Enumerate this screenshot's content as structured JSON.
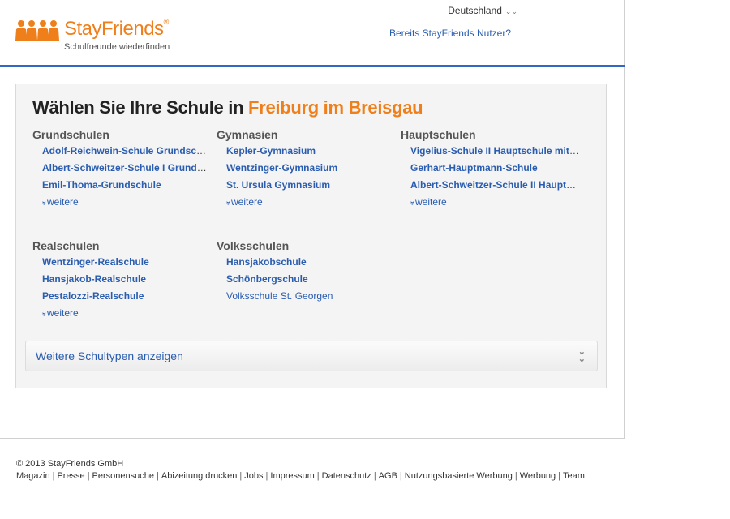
{
  "header": {
    "brand": "StayFriends",
    "brand_mark": "®",
    "tagline": "Schulfreunde wiederfinden",
    "country": "Deutschland",
    "login_link": "Bereits StayFriends Nutzer?",
    "accent_color": "#ef7f1a",
    "link_color": "#2a5db0",
    "rule_color": "#3367c7"
  },
  "main": {
    "title_prefix": "Wählen Sie Ihre Schule in",
    "city": "Freiburg im Breisgau",
    "more_label": "weitere",
    "more_icon": "double-chevron-down-icon",
    "categories": [
      {
        "name": "Grundschulen",
        "schools": [
          "Adolf-Reichwein-Schule Grundschule",
          "Albert-Schweitzer-Schule I Grundschule",
          "Emil-Thoma-Grundschule"
        ],
        "has_more": true
      },
      {
        "name": "Gymnasien",
        "schools": [
          "Kepler-Gymnasium",
          "Wentzinger-Gymnasium",
          "St. Ursula Gymnasium"
        ],
        "has_more": true
      },
      {
        "name": "Hauptschulen",
        "schools": [
          "Vigelius-Schule II Hauptschule mit Werkrealschule",
          "Gerhart-Hauptmann-Schule",
          "Albert-Schweitzer-Schule II Hauptschule"
        ],
        "has_more": true
      },
      {
        "name": "Realschulen",
        "schools": [
          "Wentzinger-Realschule",
          "Hansjakob-Realschule",
          "Pestalozzi-Realschule"
        ],
        "has_more": true
      },
      {
        "name": "Volksschulen",
        "schools": [
          "Hansjakobschule",
          "Schönbergschule",
          "Volksschule St. Georgen"
        ],
        "has_more": false
      }
    ],
    "more_types_label": "Weitere Schultypen anzeigen"
  },
  "footer": {
    "copyright": "© 2013 StayFriends GmbH",
    "links": [
      "Magazin",
      "Presse",
      "Personensuche",
      "Abizeitung drucken",
      "Jobs",
      "Impressum",
      "Datenschutz",
      "AGB",
      "Nutzungsbasierte Werbung",
      "Werbung",
      "Team"
    ]
  }
}
